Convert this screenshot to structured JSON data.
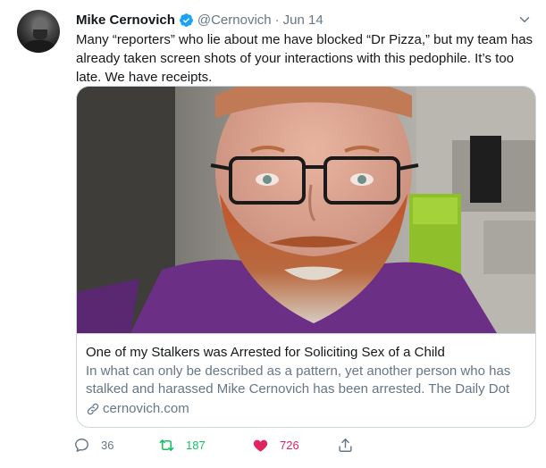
{
  "tweet": {
    "author_name": "Mike Cernovich",
    "handle": "@Cernovich",
    "separator": "·",
    "date": "Jun 14",
    "text": "Many “reporters” who lie about me have blocked “Dr Pizza,” but my team has already taken screen shots of your interactions with this pedophile. It’s too late. We have receipts."
  },
  "card": {
    "title": "One of my Stalkers was Arrested for Soliciting Sex of a Child",
    "description": "In what can only be described as a pattern, yet another person who has stalked and harassed Mike Cernovich has been arrested. The Daily Dot",
    "link": "cernovich.com"
  },
  "actions": {
    "replies": "36",
    "retweets": "187",
    "likes": "726"
  },
  "colors": {
    "accent": "#1da1f2",
    "retweet": "#17bf63",
    "like": "#e0245e",
    "secondary_text": "#657786"
  },
  "icons": [
    "verified-badge-icon",
    "chevron-down-icon",
    "link-icon",
    "reply-icon",
    "retweet-icon",
    "heart-icon",
    "share-icon"
  ]
}
